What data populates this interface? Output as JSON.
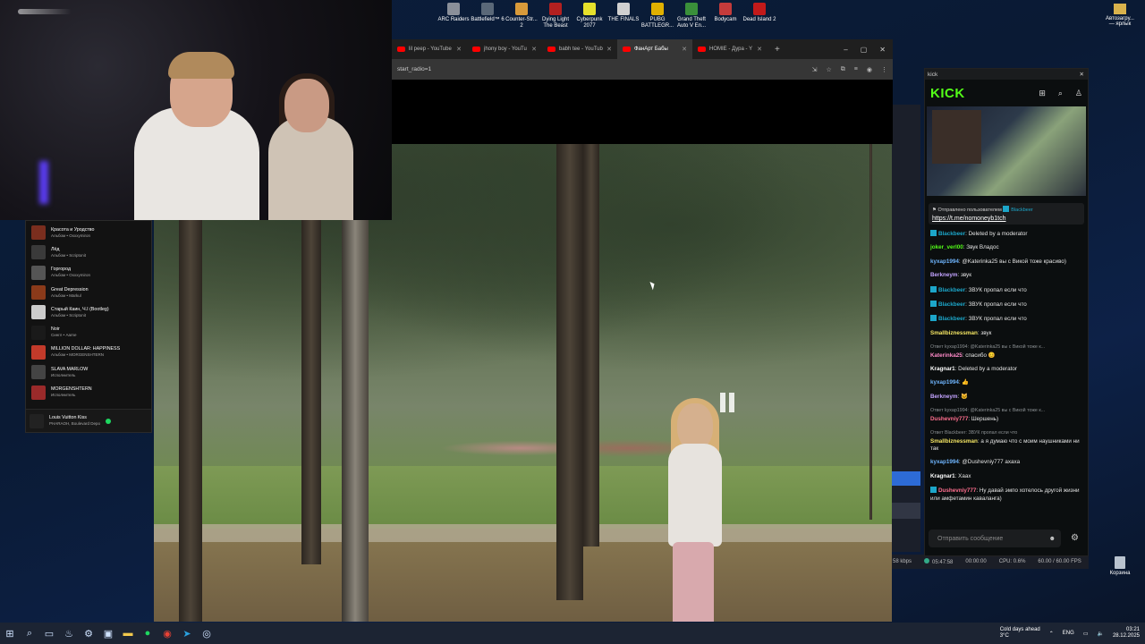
{
  "desktop": {
    "icons": [
      {
        "label": "ARC Raiders",
        "color": "#8a8f99"
      },
      {
        "label": "Battlefield™ 6",
        "color": "#5a6878"
      },
      {
        "label": "Counter-Str... 2",
        "color": "#d89a3a"
      },
      {
        "label": "Dying Light The Beast",
        "color": "#b32020"
      },
      {
        "label": "Cyberpunk 2077",
        "color": "#e6e02b"
      },
      {
        "label": "THE FINALS",
        "color": "#d0d0d0"
      },
      {
        "label": "PUBG BATTLEGR...",
        "color": "#e0b000"
      },
      {
        "label": "Grand Theft Auto V En...",
        "color": "#3a8f3a"
      },
      {
        "label": "Bodycam",
        "color": "#c43b3b"
      },
      {
        "label": "Dead Island 2",
        "color": "#c21a1a"
      }
    ],
    "right_icon": "Автозагру... — ярлык",
    "trash": "Корзина"
  },
  "spotify": {
    "items": [
      {
        "title": "Красота и Уродство",
        "sub": "Альбом • Oxxxymiron",
        "color": "#7a2e1e"
      },
      {
        "title": "Лёд",
        "sub": "Альбом • Scriptonit",
        "color": "#3a3a3a"
      },
      {
        "title": "Горгород",
        "sub": "Альбом • Oxxxymiron",
        "color": "#555"
      },
      {
        "title": "Great Depression",
        "sub": "Альбом • Markul",
        "color": "#8a3a1a"
      },
      {
        "title": "Старый Каин, Ч.I (Bootleg)",
        "sub": "Альбом • Scriptonit",
        "color": "#ccc"
      },
      {
        "title": "Noir",
        "sub": "Сингл • Aarne",
        "color": "#1a1a1a"
      },
      {
        "title": "MILLION DOLLAR: HAPPINESS",
        "sub": "Альбом • MORGENSHTERN",
        "color": "#c23a2a"
      },
      {
        "title": "SLAVA MARLOW",
        "sub": "Исполнитель",
        "color": "#444"
      },
      {
        "title": "MORGENSHTERN",
        "sub": "Исполнитель",
        "color": "#9a2a2a"
      }
    ],
    "now_playing": {
      "title": "Louis Vuitton Kiss",
      "sub": "PHARAOH, Boulevard Depo"
    }
  },
  "browser": {
    "tabs": [
      {
        "label": "lil peep - YouTube",
        "active": false
      },
      {
        "label": "jhony boy - YouTu",
        "active": false
      },
      {
        "label": "babh tee - YouTub",
        "active": false
      },
      {
        "label": "ФанАрт Бабы",
        "active": true
      },
      {
        "label": "HOMIE - Дура - Y",
        "active": false
      }
    ],
    "url": "start_radio=1",
    "controls": [
      "–",
      "▢",
      "✕"
    ]
  },
  "video": {
    "state": "paused"
  },
  "obs": {
    "bitrate": "58 kbps",
    "live_time": "05:47:58",
    "rec_time": "00:00:00",
    "cpu": "CPU: 0.6%",
    "fps": "60.00 / 60.00 FPS"
  },
  "kick": {
    "window_title": "kick",
    "logo": "KICK",
    "pinned": {
      "label": "Отправлено пользователем",
      "user": "Blackbeer",
      "link": "https://t.me/nomoneyb1tch"
    },
    "messages": [
      {
        "user": "Blackbeer",
        "color": "#1ca6c9",
        "badge": true,
        "text": "Deleted by a moderator",
        "reply": ""
      },
      {
        "user": "joker_verl00",
        "color": "#53fc18",
        "badge": false,
        "text": "Звук Владос",
        "reply": ""
      },
      {
        "user": "kyxap1994",
        "color": "#6fb6ff",
        "badge": false,
        "text": "@Katerinka25 вы с Викой тоже красиво)",
        "reply": ""
      },
      {
        "user": "Berkneym",
        "color": "#c3a3ff",
        "badge": false,
        "text": "звук",
        "reply": ""
      },
      {
        "user": "Blackbeer",
        "color": "#1ca6c9",
        "badge": true,
        "text": "ЗВУК пропал если что",
        "reply": ""
      },
      {
        "user": "Blackbeer",
        "color": "#1ca6c9",
        "badge": true,
        "text": "ЗВУК пропал если что",
        "reply": ""
      },
      {
        "user": "Blackbeer",
        "color": "#1ca6c9",
        "badge": true,
        "text": "ЗВУК пропал если что",
        "reply": ""
      },
      {
        "user": "Smallbiznessman",
        "color": "#f5e663",
        "badge": false,
        "text": "звук",
        "reply": ""
      },
      {
        "user": "Katerinka25",
        "color": "#ff8ac8",
        "badge": false,
        "text": "спасибо 😊",
        "reply": "Ответ kyxap1994: @Katerinka25 вы с Викой тоже к..."
      },
      {
        "user": "Kragnar1",
        "color": "#fff",
        "badge": false,
        "text": "Deleted by a moderator",
        "reply": ""
      },
      {
        "user": "kyxap1994",
        "color": "#6fb6ff",
        "badge": false,
        "text": "👍",
        "reply": ""
      },
      {
        "user": "Berkneym",
        "color": "#c3a3ff",
        "badge": false,
        "text": "🐱",
        "reply": ""
      },
      {
        "user": "Dushevniy777",
        "color": "#ff6f8f",
        "badge": false,
        "text": "Шершень)",
        "reply": "Ответ kyxap1994: @Katerinka25 вы с Викой тоже к..."
      },
      {
        "user": "Smallbiznessman",
        "color": "#f5e663",
        "badge": false,
        "text": "а я думаю что с моим наушниками ни так",
        "reply": "Ответ Blackbeer: ЗВУК пропал если что"
      },
      {
        "user": "kyxap1994",
        "color": "#6fb6ff",
        "badge": false,
        "text": "@Dushevniy777 ахаха",
        "reply": ""
      },
      {
        "user": "Kragnar1",
        "color": "#fff",
        "badge": false,
        "text": "Хаах",
        "reply": ""
      },
      {
        "user": "Dushevniy777",
        "color": "#ff6f8f",
        "badge": true,
        "text": "Ну давай эмпо хотелось другой жизни или амфетамин каваланга)",
        "reply": ""
      }
    ],
    "input_placeholder": "Отправить сообщение"
  },
  "taskbar": {
    "weather_title": "Cold days ahead",
    "weather_temp": "3°C",
    "lang": "ENG",
    "time": "03:21",
    "date": "28.12.2025"
  }
}
